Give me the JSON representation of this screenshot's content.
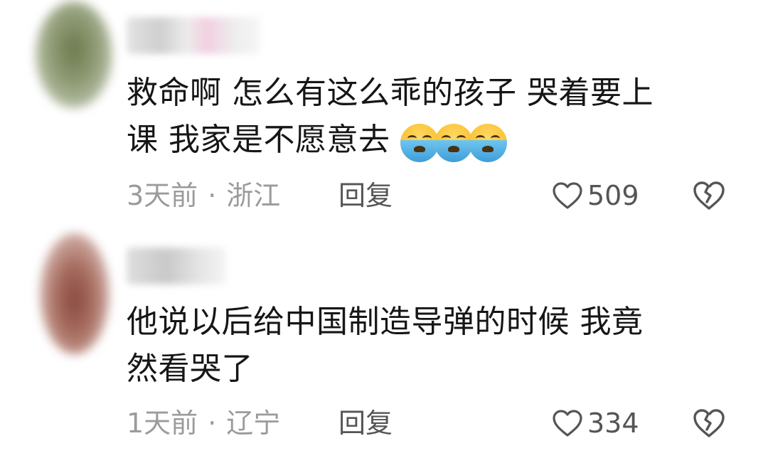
{
  "comments": [
    {
      "text_line1": "救命啊 怎么有这么乖的孩子 哭着要上",
      "text_line2": "课 我家是不愿意去",
      "emoji": [
        "loudly-crying-face",
        "loudly-crying-face",
        "loudly-crying-face"
      ],
      "time": "3天前",
      "separator": "·",
      "location": "浙江",
      "reply_label": "回复",
      "likes": "509"
    },
    {
      "text_line1": "他说以后给中国制造导弹的时候  我竟",
      "text_line2": "然看哭了",
      "time": "1天前",
      "separator": "·",
      "location": "辽宁",
      "reply_label": "回复",
      "likes": "334"
    }
  ],
  "colors": {
    "text": "#161616",
    "meta": "#9b9b9b",
    "action": "#555555"
  }
}
